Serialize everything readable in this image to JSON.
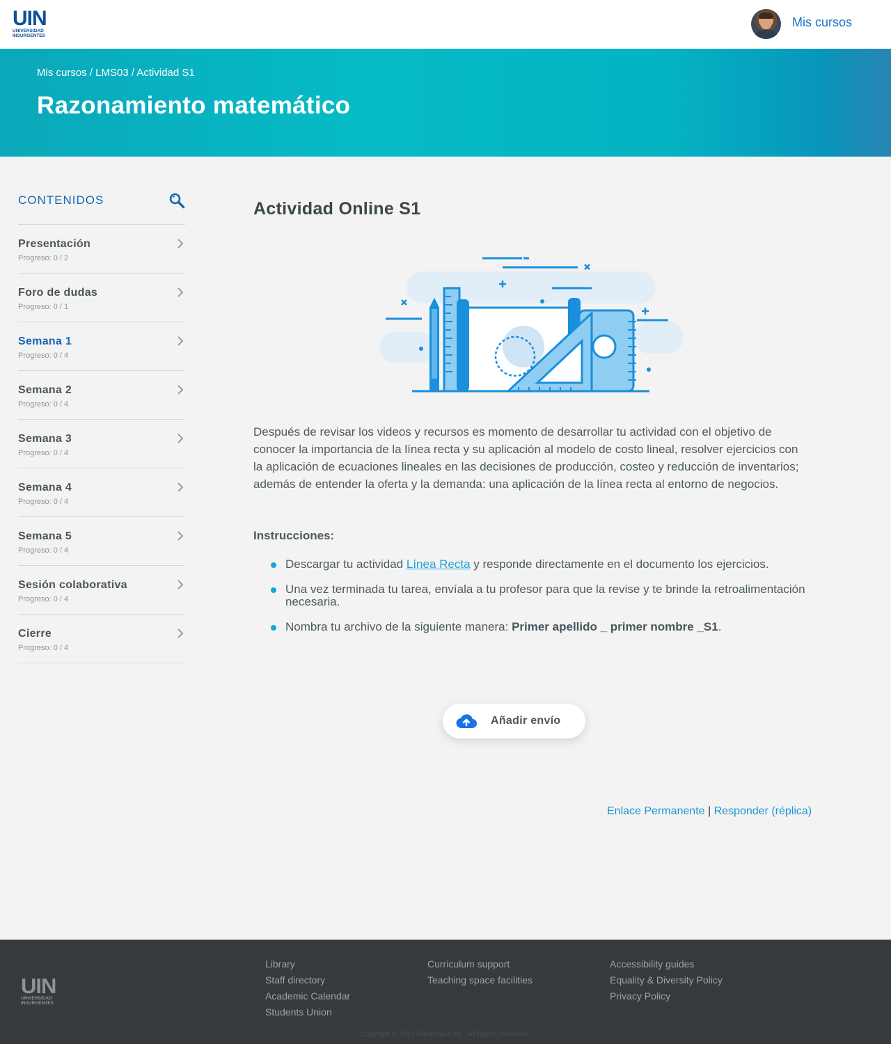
{
  "brand": {
    "logo_main": "UIN",
    "logo_line1": "UNIVERSIDAD",
    "logo_line2": "INSURGENTES"
  },
  "header": {
    "user_link": "Mis cursos"
  },
  "banner": {
    "breadcrumb": "Mis cursos / LMS03 / Actividad S1",
    "course_title": "Razonamiento matemático"
  },
  "sidebar": {
    "title": "CONTENIDOS",
    "items": [
      {
        "label": "Presentación",
        "progress": "Progreso: 0 / 2"
      },
      {
        "label": "Foro de dudas",
        "progress": "Progreso: 0 / 1"
      },
      {
        "label": "Semana 1",
        "progress": "Progreso: 0 / 4"
      },
      {
        "label": "Semana 2",
        "progress": "Progreso: 0 / 4"
      },
      {
        "label": "Semana 3",
        "progress": "Progreso: 0 / 4"
      },
      {
        "label": "Semana 4",
        "progress": "Progreso: 0 / 4"
      },
      {
        "label": "Semana 5",
        "progress": "Progreso: 0 / 4"
      },
      {
        "label": "Sesión colaborativa",
        "progress": "Progreso: 0 / 4"
      },
      {
        "label": "Cierre",
        "progress": "Progreso: 0 / 4"
      }
    ]
  },
  "main": {
    "title": "Actividad Online S1",
    "description": "Después de revisar los videos y recursos es momento de desarrollar tu actividad con el objetivo de conocer la importancia de la línea recta y su aplicación al modelo de costo lineal, resolver ejercicios con la aplicación de ecuaciones lineales en las decisiones de producción, costeo y reducción de inventarios; además de entender la oferta y la demanda: una aplicación de la línea recta al entorno de negocios.",
    "instructions_title": "Instrucciones:",
    "bullet1_pre": "Descargar tu actividad ",
    "bullet1_link": "Línea Recta",
    "bullet1_post": " y responde directamente en el documento los ejercicios.",
    "bullet2": "Una vez terminada tu tarea, envíala a tu profesor para que la revise y te brinde la retroalimentación necesaria.",
    "bullet3_pre": "Nombra tu archivo de la siguiente manera: ",
    "bullet3_bold": "Primer apellido _ primer nombre _S1",
    "bullet3_post": ".",
    "submit_label": "Añadir envío",
    "permalink": "Enlace Permanente",
    "separator": "|",
    "reply": "Responder (réplica)"
  },
  "footer": {
    "col1": [
      "Library",
      "Staff directory",
      "Academic Calendar",
      "Students Union"
    ],
    "col2": [
      "Curriculum support",
      "Teaching space facilities"
    ],
    "col3": [
      "Accessibility guides",
      "Equality & Diversity Policy",
      "Privacy Policy"
    ],
    "copyright": "Copyright © 2019 Blackboard Inc., All Rights Reserved."
  },
  "colors": {
    "accent": "#1767b0",
    "bullet": "#1aa3dc",
    "banner_start": "#0aa8ba",
    "banner_end": "#2a86b3",
    "footer_bg": "#343a3e"
  },
  "icons": {
    "search": "search-icon",
    "chevron": "chevron-right-icon",
    "upload": "cloud-upload-icon"
  }
}
